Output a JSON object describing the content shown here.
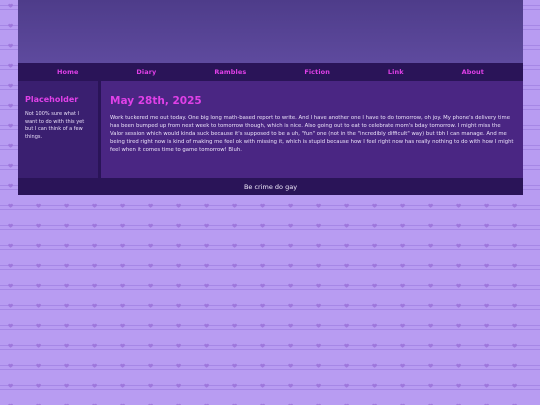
{
  "nav": {
    "items": [
      {
        "label": "Home"
      },
      {
        "label": "Diary"
      },
      {
        "label": "Rambles"
      },
      {
        "label": "Fiction"
      },
      {
        "label": "Link"
      },
      {
        "label": "About"
      }
    ]
  },
  "sidebar": {
    "title": "Placeholder",
    "text": "Not 100% sure what I want to do with this yet but I can think of a few things."
  },
  "post": {
    "date": "May 28th, 2025",
    "body": "Work tuckered me out today. One big long math-based report to write. And I have another one I have to do tomorrow, oh joy. My phone's delivery time has been bumped up from next week to tomorrow though, which is nice. Also going out to eat to celebrate mom's bday tomorrow. I might miss the Valor session which would kinda suck because it's supposed to be a uh, \"fun\" one (not in the \"incredibly difficult\" way) but tbh I can manage. And me being tired right now is kind of making me feel ok with missing it, which is stupid because how I feel right now has really nothing to do with how I might feel when it comes time to game tomorrow! Bluh."
  },
  "footer": {
    "text": "Be crime do gay"
  },
  "colors": {
    "background": "#b89cf2",
    "accent": "#e040e8",
    "nav_bg": "#2a1458",
    "sidebar_bg": "#3a1f70",
    "main_bg": "#4a2683"
  },
  "icons": {
    "pattern": "heart-icon"
  }
}
